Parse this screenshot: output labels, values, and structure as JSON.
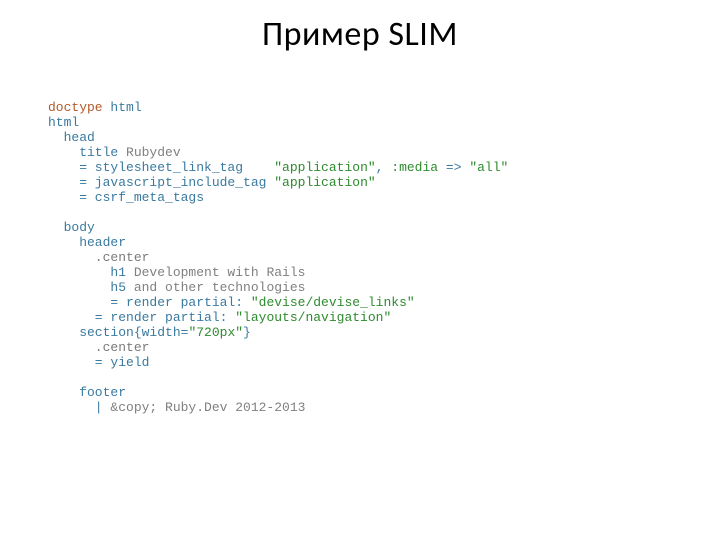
{
  "title": "Пример SLIM",
  "code": {
    "l1": {
      "kw": "doctype",
      "rest": " html"
    },
    "l2": "html",
    "l3": "  head",
    "l4": {
      "tag": "    title",
      "txt": " Rubydev"
    },
    "l5": {
      "pre": "    = stylesheet_link_tag    ",
      "s1": "\"application\"",
      "mid": ", ",
      "sym": ":media",
      "mid2": " => ",
      "s2": "\"all\""
    },
    "l6": {
      "pre": "    = javascript_include_tag ",
      "s1": "\"application\""
    },
    "l7": "    = csrf_meta_tags",
    "l8": "",
    "l9": "  body",
    "l10": "    header",
    "l11": "      .center",
    "l12": {
      "tag": "        h1",
      "txt": " Development with Rails"
    },
    "l13": {
      "tag": "        h5",
      "txt": " and other technologies"
    },
    "l14": {
      "pre": "        = render partial: ",
      "s1": "\"devise/devise_links\""
    },
    "l15": {
      "pre": "      = render partial: ",
      "s1": "\"layouts/navigation\""
    },
    "l16": {
      "pre": "    section{width=",
      "s1": "\"720px\"",
      "post": "}"
    },
    "l17": "      .center",
    "l18": "      = yield",
    "l19": "",
    "l20": "    footer",
    "l21": {
      "pipe": "      |",
      "txt": " &copy; Ruby.Dev 2012-2013"
    }
  }
}
